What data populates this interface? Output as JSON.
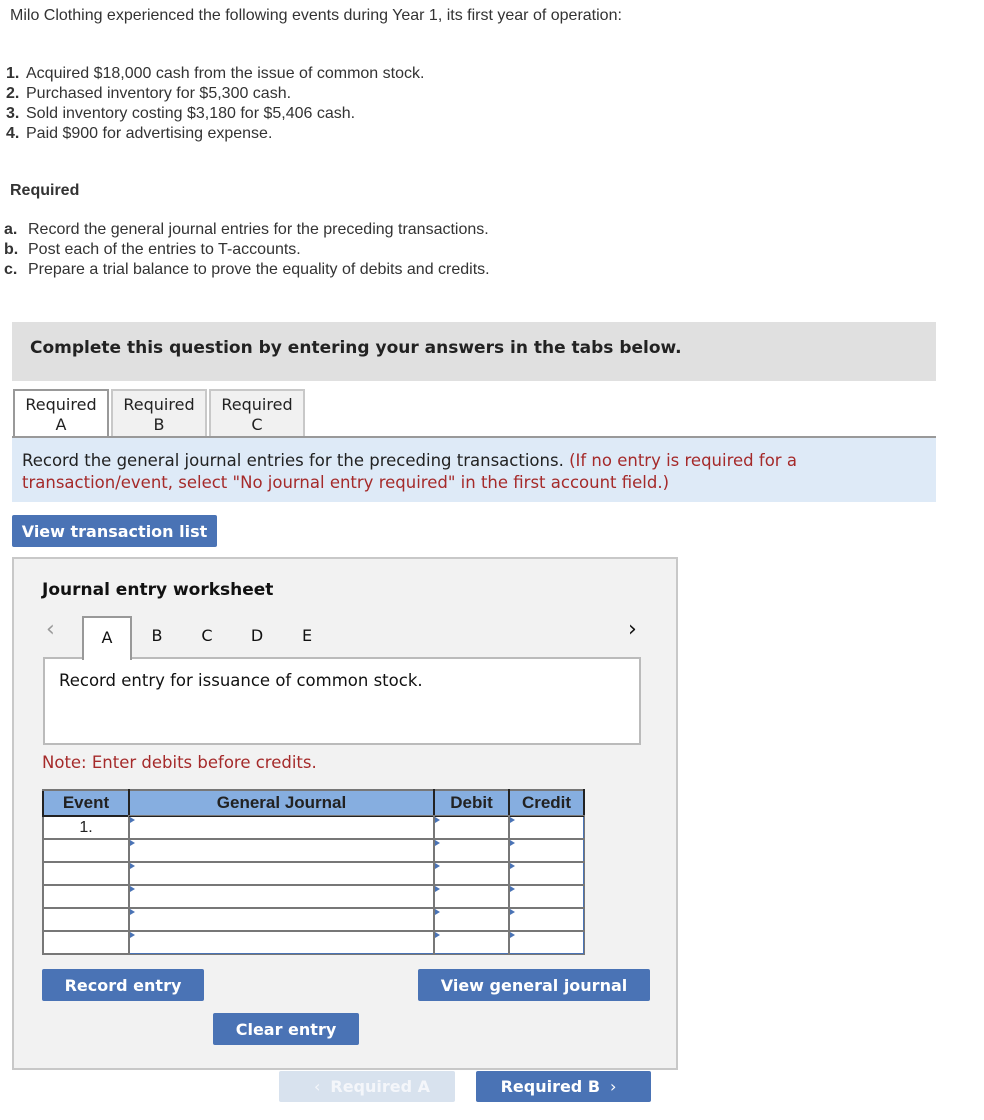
{
  "intro": "Milo Clothing experienced the following events during Year 1, its first year of operation:",
  "events": [
    {
      "num": "1.",
      "text": "Acquired $18,000 cash from the issue of common stock."
    },
    {
      "num": "2.",
      "text": "Purchased inventory for $5,300 cash."
    },
    {
      "num": "3.",
      "text": "Sold inventory costing $3,180 for $5,406 cash."
    },
    {
      "num": "4.",
      "text": "Paid $900 for advertising expense."
    }
  ],
  "required": {
    "title": "Required",
    "items": [
      {
        "num": "a.",
        "text": "Record the general journal entries for the preceding transactions."
      },
      {
        "num": "b.",
        "text": "Post each of the entries to T-accounts."
      },
      {
        "num": "c.",
        "text": "Prepare a trial balance to prove the equality of debits and credits."
      }
    ]
  },
  "banner": "Complete this question by entering your answers in the tabs below.",
  "tabs": [
    {
      "line1": "Required",
      "line2": "A",
      "active": true
    },
    {
      "line1": "Required",
      "line2": "B",
      "active": false
    },
    {
      "line1": "Required",
      "line2": "C",
      "active": false
    }
  ],
  "instruction": {
    "main": "Record the general journal entries for the preceding transactions. ",
    "note": "(If no entry is required for a transaction/event, select \"No journal entry required\" in the first account field.)"
  },
  "view_transaction_list": "View transaction list",
  "worksheet": {
    "title": "Journal entry worksheet",
    "prev_icon": "‹",
    "next_icon": "›",
    "tabs": [
      "A",
      "B",
      "C",
      "D",
      "E"
    ],
    "active_tab": "A",
    "description": "Record entry for issuance of common stock.",
    "note": "Note: Enter debits before credits.",
    "table": {
      "headers": [
        "Event",
        "General Journal",
        "Debit",
        "Credit"
      ],
      "rows": [
        {
          "event": "1.",
          "account": "",
          "debit": "",
          "credit": ""
        },
        {
          "event": "",
          "account": "",
          "debit": "",
          "credit": ""
        },
        {
          "event": "",
          "account": "",
          "debit": "",
          "credit": ""
        },
        {
          "event": "",
          "account": "",
          "debit": "",
          "credit": ""
        },
        {
          "event": "",
          "account": "",
          "debit": "",
          "credit": ""
        },
        {
          "event": "",
          "account": "",
          "debit": "",
          "credit": ""
        }
      ]
    },
    "record_entry": "Record entry",
    "view_general_journal": "View general journal",
    "clear_entry": "Clear entry"
  },
  "nav": {
    "prev_label": "Required A",
    "next_label": "Required B",
    "prev_icon": "‹",
    "next_icon": "›"
  },
  "colors": {
    "button_blue": "#4a73b5",
    "header_blue": "#86aee0",
    "instruction_bg": "#deeaf7",
    "note_red": "#a52a2a"
  }
}
